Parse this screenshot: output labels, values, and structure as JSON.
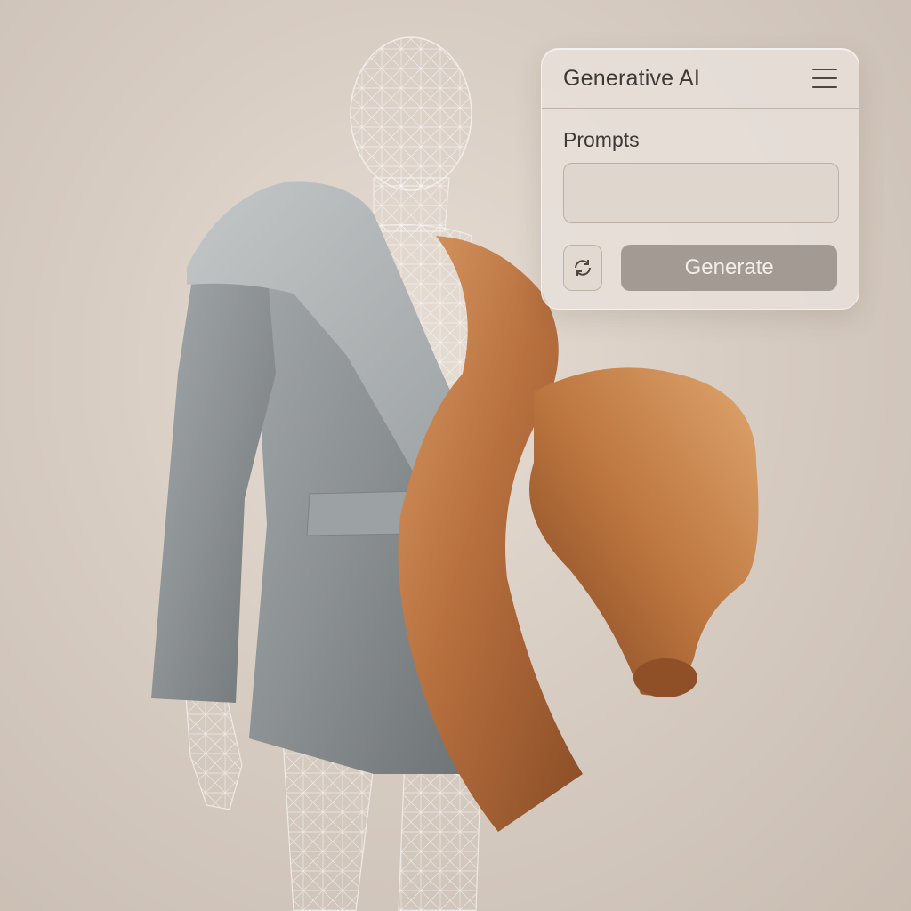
{
  "panel": {
    "title": "Generative AI",
    "menu_icon": "hamburger-menu-icon",
    "prompts_label": "Prompts",
    "prompt_value": "",
    "prompt_placeholder": "",
    "refresh_icon": "refresh-icon",
    "generate_label": "Generate"
  },
  "colors": {
    "background": "#d8cdc3",
    "coat_gray": "#8d9294",
    "silk_copper": "#b8703f",
    "wireframe": "#ffffff",
    "generate_button": "#a39a93"
  }
}
